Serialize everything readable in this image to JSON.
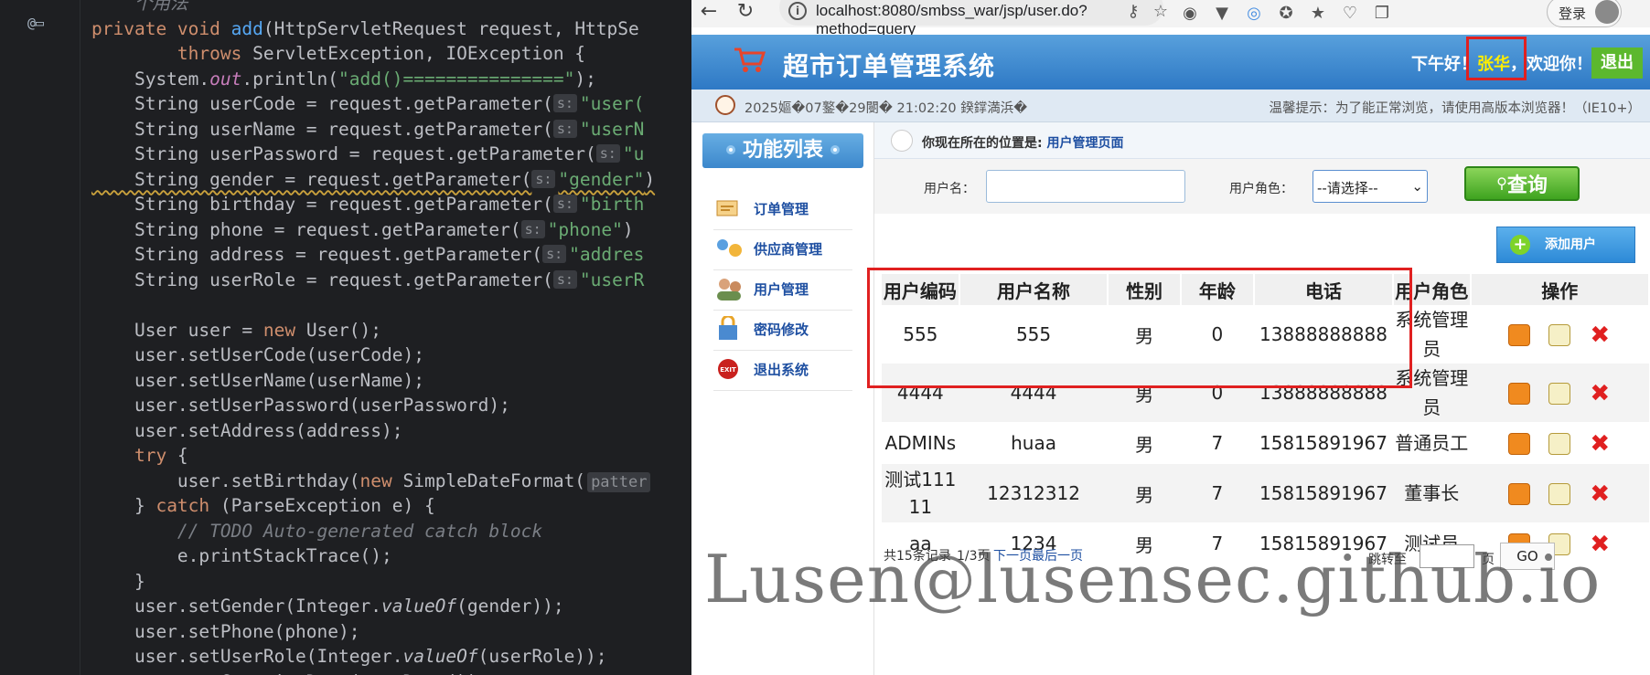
{
  "ide": {
    "gutter_mark": "@▭",
    "lines": [
      [
        "",
        [
          [
            "cm",
            "    个用法"
          ]
        ]
      ],
      [
        "",
        [
          [
            "kw",
            "private "
          ],
          [
            "kw",
            "void "
          ],
          [
            "fn",
            "add"
          ],
          [
            "t",
            "(HttpServletRequest request, HttpSe"
          ]
        ]
      ],
      [
        "",
        [
          [
            "t",
            "        "
          ],
          [
            "kw",
            "throws "
          ],
          [
            "t",
            "ServletException, IOException {"
          ]
        ]
      ],
      [
        "",
        [
          [
            "t",
            "    System."
          ],
          [
            "fld",
            "out"
          ],
          [
            "t",
            ".println("
          ],
          [
            "str",
            "\"add()===============\""
          ],
          [
            "t",
            ");"
          ]
        ]
      ],
      [
        "",
        [
          [
            "t",
            "    String userCode = request.getParameter("
          ],
          [
            "hint",
            "s:"
          ],
          [
            "str",
            "\"user("
          ]
        ]
      ],
      [
        "",
        [
          [
            "t",
            "    String userName = request.getParameter("
          ],
          [
            "hint",
            "s:"
          ],
          [
            "str",
            "\"userN"
          ]
        ]
      ],
      [
        "",
        [
          [
            "t",
            "    String userPassword = request.getParameter("
          ],
          [
            "hint",
            "s:"
          ],
          [
            "str",
            "\"u"
          ]
        ]
      ],
      [
        "sq",
        [
          [
            "t",
            "    String gender = request.getParameter("
          ],
          [
            "hint",
            "s:"
          ],
          [
            "str",
            "\"gender\""
          ],
          [
            "t",
            ")"
          ]
        ]
      ],
      [
        "",
        [
          [
            "t",
            "    String birthday = request.getParameter("
          ],
          [
            "hint",
            "s:"
          ],
          [
            "str",
            "\"birth"
          ]
        ]
      ],
      [
        "",
        [
          [
            "t",
            "    String phone = request.getParameter("
          ],
          [
            "hint",
            "s:"
          ],
          [
            "str",
            "\"phone\""
          ],
          [
            "t",
            ")"
          ]
        ]
      ],
      [
        "",
        [
          [
            "t",
            "    String address = request.getParameter("
          ],
          [
            "hint",
            "s:"
          ],
          [
            "str",
            "\"addres"
          ]
        ]
      ],
      [
        "",
        [
          [
            "t",
            "    String userRole = request.getParameter("
          ],
          [
            "hint",
            "s:"
          ],
          [
            "str",
            "\"userR"
          ]
        ]
      ],
      [
        "",
        [
          [
            "t",
            ""
          ]
        ]
      ],
      [
        "",
        [
          [
            "t",
            "    User user = "
          ],
          [
            "kw",
            "new "
          ],
          [
            "t",
            "User();"
          ]
        ]
      ],
      [
        "",
        [
          [
            "t",
            "    user.setUserCode(userCode);"
          ]
        ]
      ],
      [
        "",
        [
          [
            "t",
            "    user.setUserName(userName);"
          ]
        ]
      ],
      [
        "",
        [
          [
            "t",
            "    user.setUserPassword(userPassword);"
          ]
        ]
      ],
      [
        "",
        [
          [
            "t",
            "    user.setAddress(address);"
          ]
        ]
      ],
      [
        "",
        [
          [
            "kw",
            "    try "
          ],
          [
            "t",
            "{"
          ]
        ]
      ],
      [
        "",
        [
          [
            "t",
            "        user.setBirthday("
          ],
          [
            "kw",
            "new "
          ],
          [
            "t",
            "SimpleDateFormat("
          ],
          [
            "hintw",
            "patter"
          ]
        ]
      ],
      [
        "",
        [
          [
            "t",
            "    } "
          ],
          [
            "kw",
            "catch "
          ],
          [
            "t",
            "(ParseException e) {"
          ]
        ]
      ],
      [
        "",
        [
          [
            "cm",
            "        // TODO Auto-generated catch block"
          ]
        ]
      ],
      [
        "",
        [
          [
            "t",
            "        e.printStackTrace();"
          ]
        ]
      ],
      [
        "",
        [
          [
            "t",
            "    }"
          ]
        ]
      ],
      [
        "",
        [
          [
            "t",
            "    user.setGender(Integer."
          ],
          [
            "it",
            "valueOf"
          ],
          [
            "t",
            "(gender));"
          ]
        ]
      ],
      [
        "",
        [
          [
            "t",
            "    user.setPhone(phone);"
          ]
        ]
      ],
      [
        "",
        [
          [
            "t",
            "    user.setUserRole(Integer."
          ],
          [
            "it",
            "valueOf"
          ],
          [
            "t",
            "(userRole));"
          ]
        ]
      ],
      [
        "",
        [
          [
            "t",
            "    user.setCreationDate(new Date());"
          ]
        ]
      ]
    ]
  },
  "browser": {
    "url": "localhost:8080/smbss_war/jsp/user.do?method=query",
    "login_label": "登录"
  },
  "header": {
    "title": "超市订单管理系统",
    "greet_prefix": "下午好！",
    "user_name": "张华",
    "greet_suffix": "，欢迎你！",
    "logout": "退出"
  },
  "time_bar": {
    "time_text": "2025嫗�07鐜�29閿� 21:02:20 鍨鐣満浜�",
    "tip": "温馨提示：为了能正常浏览，请使用高版本浏览器！（IE10+）"
  },
  "sidebar": {
    "title": "功能列表",
    "items": [
      {
        "label": "订单管理",
        "icon": "order-icon"
      },
      {
        "label": "供应商管理",
        "icon": "provider-icon"
      },
      {
        "label": "用户管理",
        "icon": "users-icon"
      },
      {
        "label": "密码修改",
        "icon": "password-icon"
      },
      {
        "label": "退出系统",
        "icon": "exit-icon"
      }
    ]
  },
  "location": {
    "label": "你现在所在的位置是:",
    "page": "用户管理页面"
  },
  "search": {
    "username_label": "用户名：",
    "username_value": "",
    "role_label": "用户角色：",
    "role_selected": "--请选择--",
    "query_button": "查询",
    "add_button": "添加用户"
  },
  "table": {
    "headers": [
      "用户编码",
      "用户名称",
      "性别",
      "年龄",
      "电话",
      "用户角色",
      "操作"
    ],
    "rows": [
      [
        "555",
        "555",
        "男",
        "0",
        "13888888888",
        "系统管理员"
      ],
      [
        "4444",
        "4444",
        "男",
        "0",
        "13888888888",
        "系统管理员"
      ],
      [
        "ADMINs",
        "huaa",
        "男",
        "7",
        "15815891967",
        "普通员工"
      ],
      [
        "测试11111",
        "12312312",
        "男",
        "7",
        "15815891967",
        "董事长"
      ],
      [
        "aa",
        "1234",
        "男",
        "7",
        "15815891967",
        "测试员"
      ]
    ]
  },
  "pager": {
    "total": "共15条记录",
    "page": "1/3页",
    "next": "下一页",
    "last": "最后一页",
    "jump": "跳转至",
    "unit": "页",
    "go": "GO"
  },
  "watermark": "Lusen@lusensec.github.io",
  "colors": {
    "header_blue": "#3f8bd0",
    "highlight_red": "#e02020",
    "link_blue": "#1e4fa1",
    "query_green": "#4cae24"
  }
}
